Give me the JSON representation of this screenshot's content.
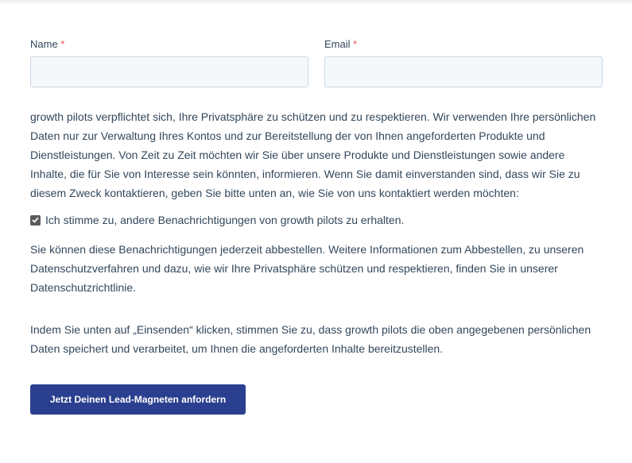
{
  "form": {
    "name_label": "Name",
    "email_label": "Email",
    "required_mark": "*",
    "name_value": "",
    "email_value": "",
    "consent_text": "growth pilots verpflichtet sich, Ihre Privatsphäre zu schützen und zu respektieren. Wir verwenden Ihre persönlichen Daten nur zur Verwaltung Ihres Kontos und zur Bereitstellung der von Ihnen angeforderten Produkte und Dienstleistungen. Von Zeit zu Zeit möchten wir Sie über unsere Produkte und Dienstleistungen sowie andere Inhalte, die für Sie von Interesse sein könnten, informieren. Wenn Sie damit einverstanden sind, dass wir Sie zu diesem Zweck kontaktieren, geben Sie bitte unten an, wie Sie von uns kontaktiert werden möchten:",
    "checkbox_label": "Ich stimme zu, andere Benachrichtigungen von growth pilots zu erhalten.",
    "checkbox_checked": true,
    "unsubscribe_text": "Sie können diese Benachrichtigungen jederzeit abbestellen. Weitere Informationen zum Abbestellen, zu unseren Datenschutzverfahren und dazu, wie wir Ihre Privatsphäre schützen und respektieren, finden Sie in unserer Datenschutzrichtlinie.",
    "submit_note": "Indem Sie unten auf „Einsenden“ klicken, stimmen Sie zu, dass growth pilots die oben angegebenen persönlichen Daten speichert und verarbeitet, um Ihnen die angeforderten Inhalte bereitzustellen.",
    "submit_label": "Jetzt Deinen Lead-Magneten anfordern"
  },
  "colors": {
    "button_bg": "#2a3f8f",
    "required": "#f2545b",
    "input_bg": "#f5f8fa",
    "text": "#33475b"
  }
}
